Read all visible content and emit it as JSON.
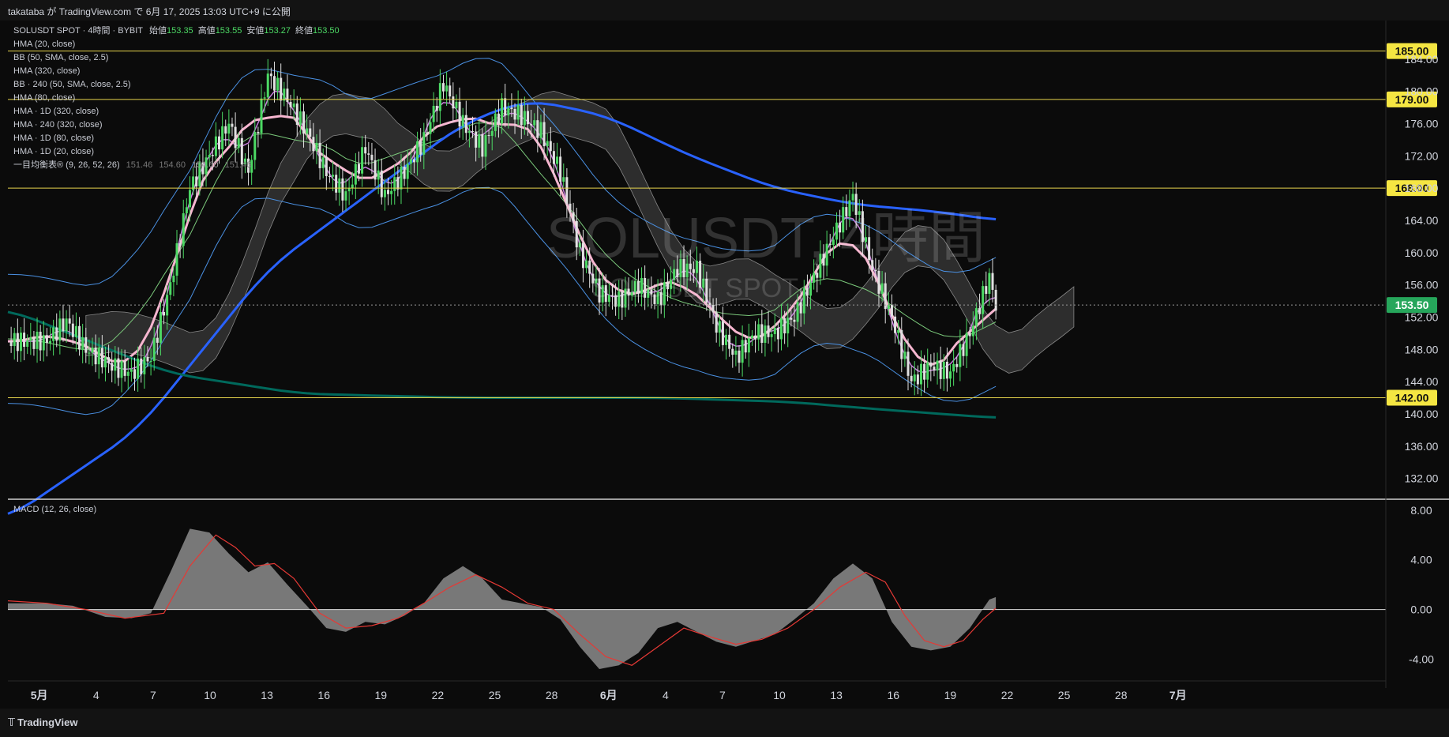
{
  "header": {
    "title": "takataba が TradingView.com で 6月 17, 2025 13:03 UTC+9 に公開"
  },
  "footer": {
    "brand": "TradingView"
  },
  "symbol": {
    "name": "SOLUSDT SPOT · 4時間 · BYBIT",
    "ohlc": [
      {
        "label": "始値",
        "value": "153.35"
      },
      {
        "label": "高値",
        "value": "153.55"
      },
      {
        "label": "安値",
        "value": "153.27"
      },
      {
        "label": "終値",
        "value": "153.50"
      }
    ],
    "watermark": "SOLUSDT, 4時間",
    "watermark_sub": "SOLUSDT SPOT"
  },
  "indicators": [
    "HMA (20, close)",
    "BB (50, SMA, close, 2.5)",
    "HMA (320, close)",
    "BB · 240 (50, SMA, close, 2.5)",
    "HMA (80, close)",
    "HMA · 1D (320, close)",
    "HMA · 240 (320, close)",
    "HMA · 1D (80, close)",
    "HMA · 1D (20, close)"
  ],
  "ichimoku": {
    "label": "一目均衡表® (9, 26, 52, 26)",
    "values": [
      "151.46",
      "154.60",
      "154.60",
      "151.46"
    ]
  },
  "macd_label": "MACD (12, 26, close)",
  "colors": {
    "up": "#4cd964",
    "down": "#e0e0e0",
    "hma20": "#c77ddb",
    "hma80": "#f7b6d0",
    "hma320": "#2962ff",
    "hma_long": "#00695c",
    "bb": "#4a90e2",
    "cloud": "#4a4a4a",
    "level_line": "#e6d44c",
    "level_bg": "#f5e642",
    "price_bg": "#26a65b"
  },
  "chart_data": [
    {
      "type": "candlestick",
      "title": "SOLUSDT SPOT · 4時間 · BYBIT",
      "x_ticks": [
        "5月",
        "4",
        "7",
        "10",
        "13",
        "16",
        "19",
        "22",
        "25",
        "28",
        "6月",
        "4",
        "7",
        "10",
        "13",
        "16",
        "19",
        "22",
        "25",
        "28",
        "7月"
      ],
      "y_ticks": [
        132,
        136,
        140,
        144,
        148,
        152,
        156,
        160,
        164,
        168,
        172,
        176,
        180,
        184
      ],
      "ylim": [
        130,
        188
      ],
      "horizontal_levels": [
        185.0,
        179.0,
        168.0,
        142.0
      ],
      "last_price": 153.5,
      "price_labels": [
        "185.00",
        "179.00",
        "168.00",
        "153.50",
        "142.00"
      ],
      "approx_close_path": [
        [
          0,
          149
        ],
        [
          6,
          149
        ],
        [
          9,
          151.5
        ],
        [
          12,
          148
        ],
        [
          16,
          146
        ],
        [
          19,
          145
        ],
        [
          22,
          147
        ],
        [
          25,
          156
        ],
        [
          28,
          168
        ],
        [
          31,
          172
        ],
        [
          34,
          176
        ],
        [
          37,
          170
        ],
        [
          40,
          182
        ],
        [
          43,
          179
        ],
        [
          46,
          175
        ],
        [
          49,
          170
        ],
        [
          52,
          167
        ],
        [
          55,
          173
        ],
        [
          58,
          167
        ],
        [
          61,
          170
        ],
        [
          64,
          174
        ],
        [
          67,
          181
        ],
        [
          70,
          176
        ],
        [
          73,
          173
        ],
        [
          76,
          178
        ],
        [
          79,
          177
        ],
        [
          82,
          175
        ],
        [
          85,
          170
        ],
        [
          88,
          160
        ],
        [
          91,
          155
        ],
        [
          94,
          154
        ],
        [
          97,
          156
        ],
        [
          100,
          154
        ],
        [
          103,
          158
        ],
        [
          106,
          158
        ],
        [
          109,
          151
        ],
        [
          112,
          147
        ],
        [
          115,
          150
        ],
        [
          118,
          150
        ],
        [
          121,
          152
        ],
        [
          124,
          157
        ],
        [
          127,
          162
        ],
        [
          130,
          167
        ],
        [
          133,
          158
        ],
        [
          136,
          152
        ],
        [
          139,
          144
        ],
        [
          142,
          146
        ],
        [
          145,
          145
        ],
        [
          148,
          150
        ],
        [
          151,
          157
        ],
        [
          152,
          153.5
        ]
      ],
      "x_range": [
        0,
        212
      ]
    },
    {
      "type": "area",
      "title": "MACD (12, 26, close)",
      "y_ticks": [
        8.0,
        4.0,
        0.0,
        -4.0
      ],
      "ylim": [
        -5.5,
        8.5
      ],
      "histogram_path": [
        [
          0,
          0.5
        ],
        [
          6,
          0.5
        ],
        [
          10,
          0.3
        ],
        [
          15,
          -0.6
        ],
        [
          19,
          -0.7
        ],
        [
          22,
          -0.3
        ],
        [
          25,
          3
        ],
        [
          28,
          6.5
        ],
        [
          31,
          6.2
        ],
        [
          34,
          4.5
        ],
        [
          37,
          3
        ],
        [
          40,
          3.8
        ],
        [
          43,
          2
        ],
        [
          46,
          0.3
        ],
        [
          49,
          -1.5
        ],
        [
          52,
          -1.8
        ],
        [
          55,
          -1
        ],
        [
          58,
          -1.2
        ],
        [
          61,
          -0.5
        ],
        [
          64,
          0.5
        ],
        [
          67,
          2.5
        ],
        [
          70,
          3.5
        ],
        [
          73,
          2.5
        ],
        [
          76,
          0.8
        ],
        [
          79,
          0.5
        ],
        [
          82,
          0.2
        ],
        [
          85,
          -0.8
        ],
        [
          88,
          -3
        ],
        [
          91,
          -4.8
        ],
        [
          94,
          -4.5
        ],
        [
          97,
          -3.5
        ],
        [
          100,
          -1.5
        ],
        [
          103,
          -1
        ],
        [
          106,
          -1.8
        ],
        [
          109,
          -2.6
        ],
        [
          112,
          -3
        ],
        [
          115,
          -2.5
        ],
        [
          118,
          -2
        ],
        [
          121,
          -0.8
        ],
        [
          124,
          0.5
        ],
        [
          127,
          2.5
        ],
        [
          130,
          3.7
        ],
        [
          133,
          2.5
        ],
        [
          136,
          -1
        ],
        [
          139,
          -3
        ],
        [
          142,
          -3.3
        ],
        [
          145,
          -3
        ],
        [
          148,
          -1.5
        ],
        [
          151,
          0.8
        ],
        [
          152,
          1.0
        ]
      ],
      "signal_path": [
        [
          0,
          0.7
        ],
        [
          6,
          0.5
        ],
        [
          12,
          0
        ],
        [
          18,
          -0.7
        ],
        [
          24,
          -0.3
        ],
        [
          28,
          3.5
        ],
        [
          32,
          6.0
        ],
        [
          35,
          5
        ],
        [
          38,
          3.5
        ],
        [
          41,
          3.7
        ],
        [
          44,
          2.5
        ],
        [
          48,
          -0.3
        ],
        [
          52,
          -1.5
        ],
        [
          56,
          -1.3
        ],
        [
          60,
          -0.7
        ],
        [
          64,
          0.5
        ],
        [
          68,
          1.8
        ],
        [
          72,
          2.8
        ],
        [
          76,
          1.8
        ],
        [
          80,
          0.5
        ],
        [
          84,
          0
        ],
        [
          88,
          -2
        ],
        [
          92,
          -3.8
        ],
        [
          96,
          -4.5
        ],
        [
          100,
          -3
        ],
        [
          104,
          -1.5
        ],
        [
          108,
          -2.2
        ],
        [
          112,
          -2.8
        ],
        [
          116,
          -2.4
        ],
        [
          120,
          -1.5
        ],
        [
          124,
          0
        ],
        [
          128,
          1.8
        ],
        [
          132,
          3
        ],
        [
          135,
          2.2
        ],
        [
          138,
          -0.5
        ],
        [
          141,
          -2.5
        ],
        [
          144,
          -3
        ],
        [
          147,
          -2.5
        ],
        [
          150,
          -0.8
        ],
        [
          152,
          0.1
        ]
      ],
      "zero_line": 0
    }
  ]
}
